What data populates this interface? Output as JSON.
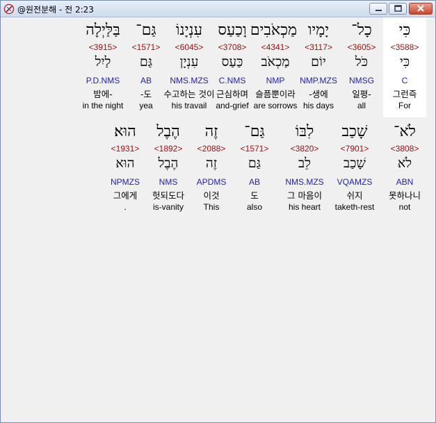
{
  "window": {
    "title": "@원전분해 - 전 2:23",
    "minimize_label": "_",
    "maximize_label": "□",
    "close_label": "X"
  },
  "rows": [
    [
      {
        "heb": "כִּי",
        "strong": "<3588>",
        "lemma": "כִּי",
        "parse": "C",
        "kor": "그런즉",
        "eng": "For"
      },
      {
        "heb": "כָל־",
        "strong": "<3605>",
        "lemma": "כֹּל",
        "parse": "NMSG",
        "kor": "일평-",
        "eng": "all"
      },
      {
        "heb": "יָמָיו",
        "strong": "<3117>",
        "lemma": "יוֹם",
        "parse": "NMP.MZS",
        "kor": "-생에",
        "eng": "his days"
      },
      {
        "heb": "מַכְאֹבִים",
        "strong": "<4341>",
        "lemma": "מַכְאֹב",
        "parse": "NMP",
        "kor": "슬픔뿐이라",
        "eng": "are sorrows"
      },
      {
        "heb": "וָכַעַס",
        "strong": "<3708>",
        "lemma": "כַּעַס",
        "parse": "C.NMS",
        "kor": "근심하며",
        "eng": "and-grief"
      },
      {
        "heb": "עִנְיָנוֹ",
        "strong": "<6045>",
        "lemma": "עִנְיָן",
        "parse": "NMS.MZS",
        "kor": "수고하는 것이",
        "eng": "his travail"
      },
      {
        "heb": "גַּם־",
        "strong": "<1571>",
        "lemma": "גַּם",
        "parse": "AB",
        "kor": "-도",
        "eng": "yea"
      },
      {
        "heb": "בַּלַּיְלָה",
        "strong": "<3915>",
        "lemma": "לַיִל",
        "parse": "P.D.NMS",
        "kor": "밤에-",
        "eng": "in the night"
      }
    ],
    [
      {
        "heb": "לֹא־",
        "strong": "<3808>",
        "lemma": "לֹא",
        "parse": "ABN",
        "kor": "못하나니",
        "eng": "not"
      },
      {
        "heb": "שָׁכַב",
        "strong": "<7901>",
        "lemma": "שָׁכַב",
        "parse": "VQAMZS",
        "kor": "쉬지",
        "eng": "taketh-rest"
      },
      {
        "heb": "לִבּוֹ",
        "strong": "<3820>",
        "lemma": "לֵב",
        "parse": "NMS.MZS",
        "kor": "그 마음이",
        "eng": "his heart"
      },
      {
        "heb": "גַּם־",
        "strong": "<1571>",
        "lemma": "גַּם",
        "parse": "AB",
        "kor": "도",
        "eng": "also"
      },
      {
        "heb": "זֶה",
        "strong": "<2088>",
        "lemma": "זֶה",
        "parse": "APDMS",
        "kor": "이것",
        "eng": "This"
      },
      {
        "heb": "הֶבֶל",
        "strong": "<1892>",
        "lemma": "הֶבֶל",
        "parse": "NMS",
        "kor": "헛되도다",
        "eng": "is-vanity"
      },
      {
        "heb": "הוּא׃",
        "strong": "<1931>",
        "lemma": "הוּא",
        "parse": "NPMZS",
        "kor": "그에게",
        "eng": "."
      }
    ]
  ]
}
